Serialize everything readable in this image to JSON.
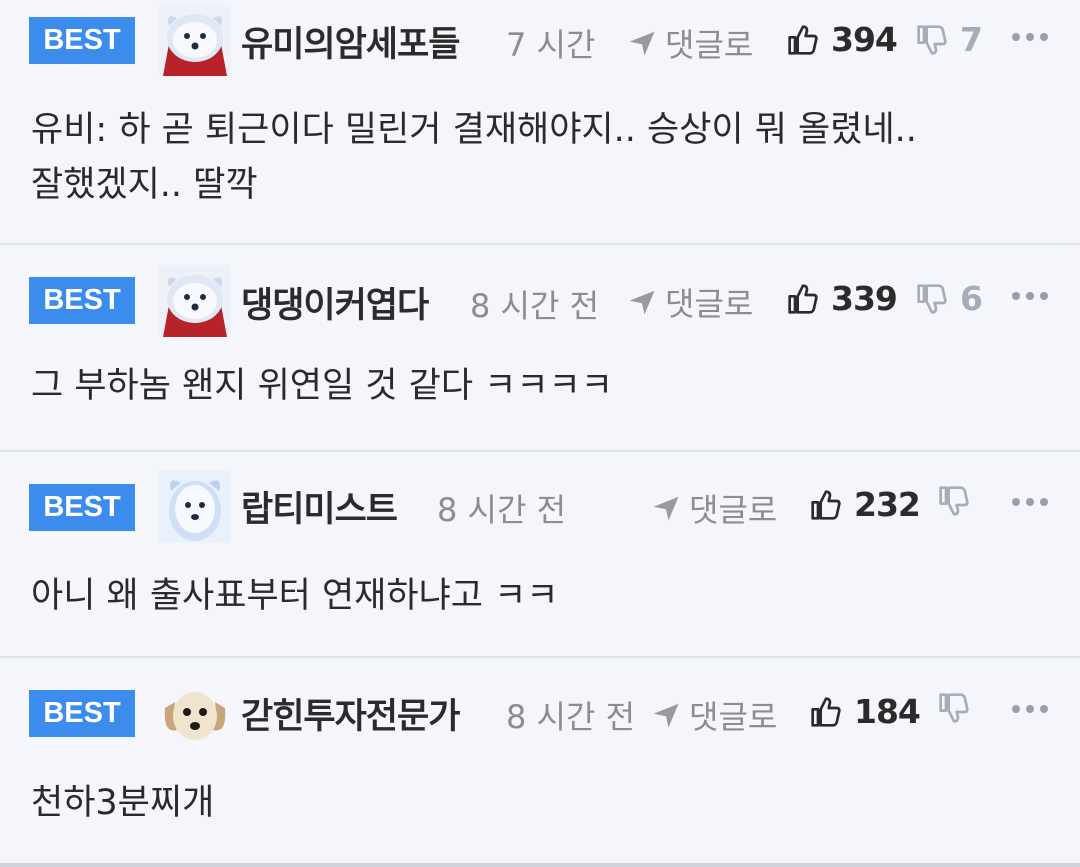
{
  "comments": [
    {
      "badge": "BEST",
      "nickname": "유미의암세포들",
      "time": "7 시간",
      "reply_label": "댓글로",
      "likes": "394",
      "dislikes": "7",
      "text": "유비: 하 곧 퇴근이다 밀린거 결재해야지.. 승상이 뭐 올렸네..\n잘했겠지.. 딸깍",
      "avatar_icon": "white-dog-caped-avatar-icon"
    },
    {
      "badge": "BEST",
      "nickname": "댕댕이커엽다",
      "time": "8 시간 전",
      "reply_label": "댓글로",
      "likes": "339",
      "dislikes": "6",
      "text": "그 부하놈 왠지 위연일 것 같다 ㅋㅋㅋㅋ",
      "avatar_icon": "white-dog-caped-avatar-icon"
    },
    {
      "badge": "BEST",
      "nickname": "랍티미스트",
      "time": "8 시간 전",
      "reply_label": "댓글로",
      "likes": "232",
      "dislikes": "",
      "text": "아니 왜 출사표부터 연재하냐고 ㅋㅋ",
      "avatar_icon": "white-dog-avatar-icon"
    },
    {
      "badge": "BEST",
      "nickname": "갇힌투자전문가",
      "time": "8 시간 전",
      "reply_label": "댓글로",
      "likes": "184",
      "dislikes": "",
      "text": "천하3분찌개",
      "avatar_icon": "puppy-face-avatar-icon"
    }
  ],
  "colors": {
    "badge": "#3c8ced",
    "background": "#f4f6fb",
    "muted": "#8d8d8d",
    "divider": "#dfe2ea"
  }
}
